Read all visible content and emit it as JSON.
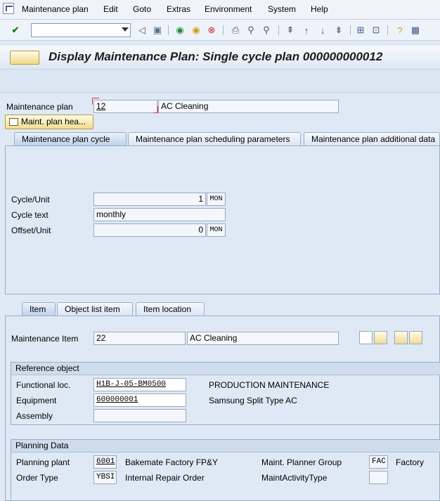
{
  "menu": {
    "items": [
      "Maintenance plan",
      "Edit",
      "Goto",
      "Extras",
      "Environment",
      "System",
      "Help"
    ]
  },
  "toolbar": {
    "command_value": ""
  },
  "title": {
    "text": "Display Maintenance Plan: Single cycle plan 000000000012"
  },
  "header": {
    "plan_label": "Maintenance plan",
    "plan_number": "12",
    "plan_text": "AC Cleaning",
    "header_button": "Maint. plan hea..."
  },
  "tabs": {
    "t1": "Maintenance plan cycle",
    "t2": "Maintenance plan scheduling parameters",
    "t3": "Maintenance plan additional data"
  },
  "cycle": {
    "cycle_unit_label": "Cycle/Unit",
    "cycle_value": "1",
    "cycle_unit": "MON",
    "cycle_text_label": "Cycle text",
    "cycle_text": "monthly",
    "offset_label": "Offset/Unit",
    "offset_value": "0",
    "offset_unit": "MON"
  },
  "item_tabs": {
    "t1": "Item",
    "t2": "Object list item",
    "t3": "Item location"
  },
  "item": {
    "label": "Maintenance Item",
    "number": "22",
    "text": "AC Cleaning"
  },
  "reference": {
    "header": "Reference object",
    "func_loc_label": "Functional loc.",
    "func_loc": "H1B-J-05-BM0500",
    "func_loc_desc": "PRODUCTION MAINTENANCE",
    "equipment_label": "Equipment",
    "equipment": "600000001",
    "equipment_desc": "Samsung Split Type AC",
    "assembly_label": "Assembly",
    "assembly": ""
  },
  "planning": {
    "header": "Planning Data",
    "plant_label": "Planning plant",
    "plant": "6001",
    "plant_desc": "Bakemate Factory FP&Y",
    "planner_group_label": "Maint. Planner Group",
    "planner_group": "FAC",
    "planner_group_desc": "Factory",
    "order_type_label": "Order Type",
    "order_type": "YBSI",
    "order_type_desc": "Internal Repair Order",
    "activity_type_label": "MaintActivityType",
    "activity_type": ""
  }
}
